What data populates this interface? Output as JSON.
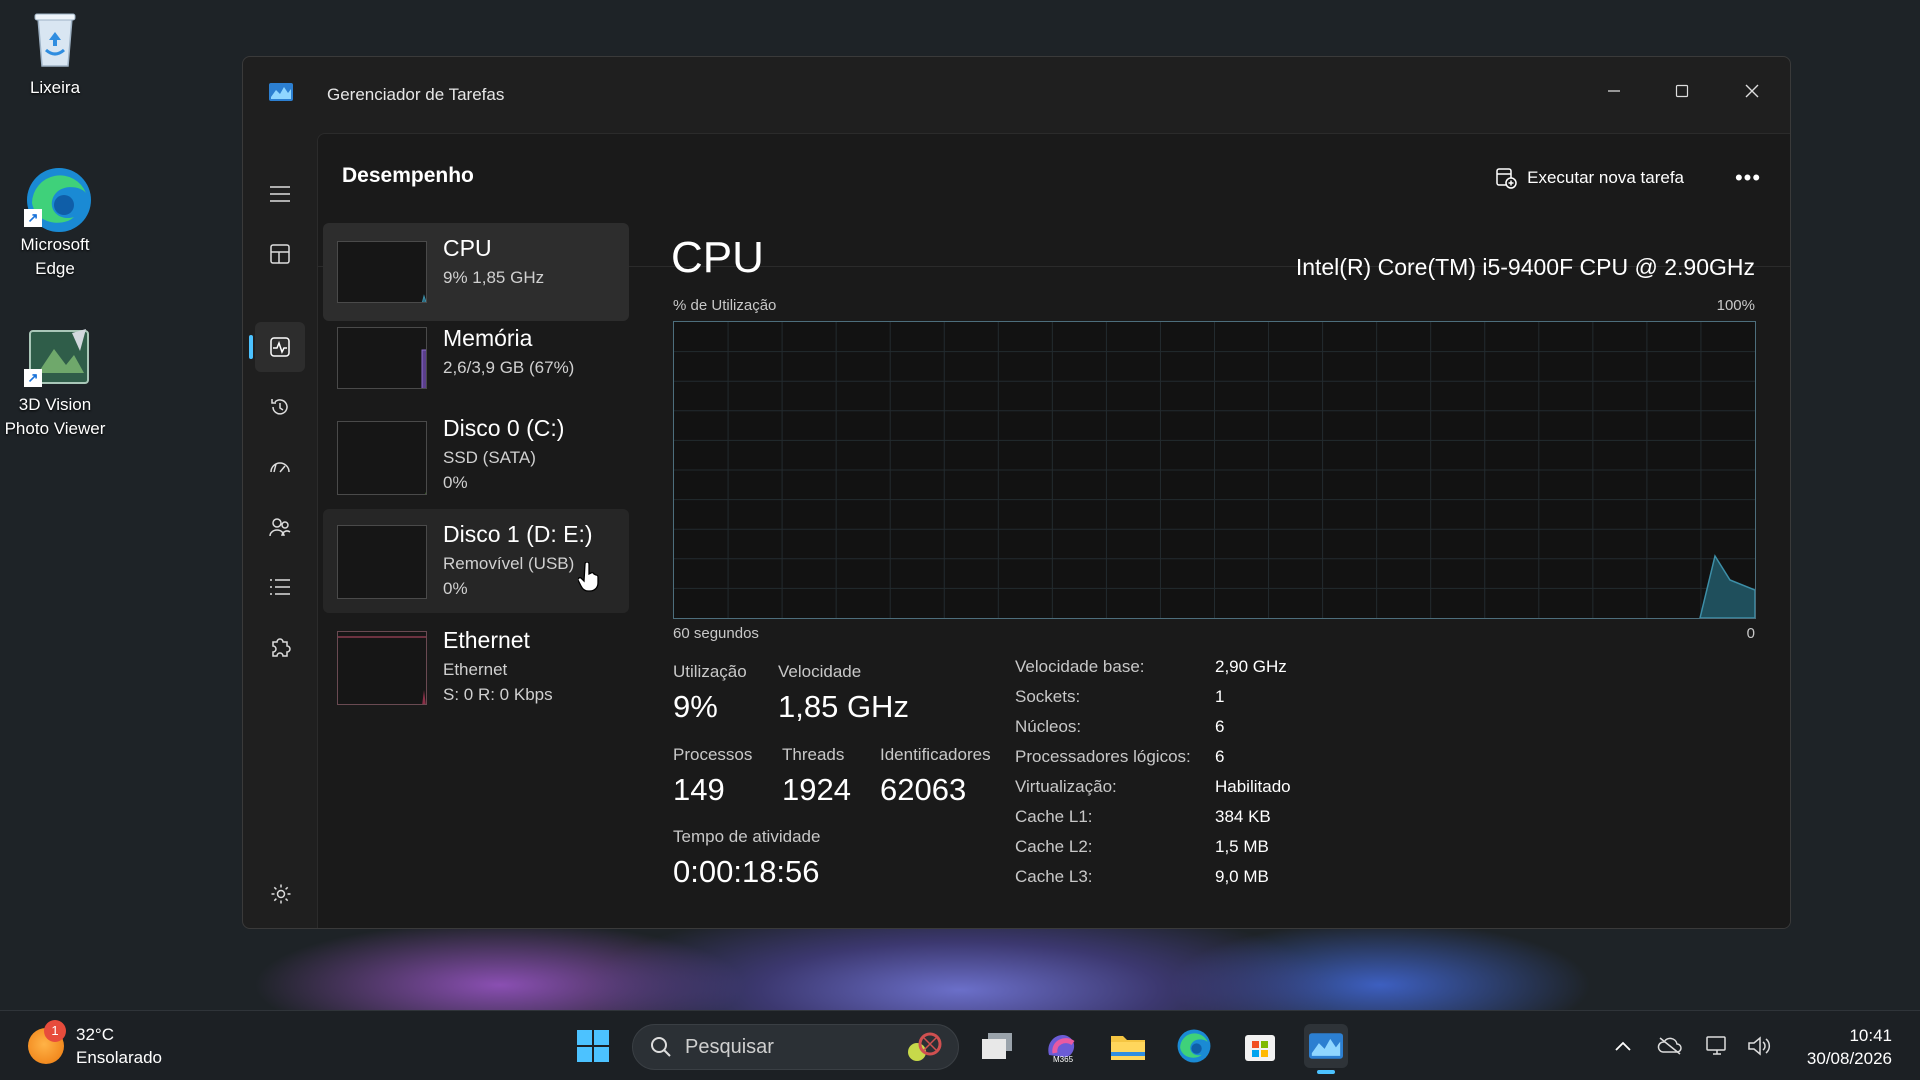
{
  "desktop": {
    "icons": [
      {
        "label": "Lixeira"
      },
      {
        "label": "Microsoft Edge"
      },
      {
        "label": "3D Vision Photo Viewer"
      }
    ]
  },
  "window": {
    "title": "Gerenciador de Tarefas",
    "page_title": "Desempenho",
    "run_task_label": "Executar nova tarefa",
    "more_label": "•••"
  },
  "perf_list": [
    {
      "name": "CPU",
      "sub1": "9%  1,85 GHz",
      "sub2": ""
    },
    {
      "name": "Memória",
      "sub1": "2,6/3,9 GB (67%)",
      "sub2": ""
    },
    {
      "name": "Disco 0 (C:)",
      "sub1": "SSD (SATA)",
      "sub2": "0%"
    },
    {
      "name": "Disco 1 (D: E:)",
      "sub1": "Removível (USB)",
      "sub2": "0%"
    },
    {
      "name": "Ethernet",
      "sub1": "Ethernet",
      "sub2": "S: 0 R: 0 Kbps"
    }
  ],
  "cpu": {
    "title": "CPU",
    "model": "Intel(R) Core(TM) i5-9400F CPU @ 2.90GHz",
    "graph_label": "% de Utilização",
    "graph_max": "100%",
    "graph_time": "60 segundos",
    "graph_min": "0",
    "stats": {
      "utilizacao_label": "Utilização",
      "utilizacao": "9%",
      "velocidade_label": "Velocidade",
      "velocidade": "1,85 GHz",
      "processos_label": "Processos",
      "processos": "149",
      "threads_label": "Threads",
      "threads": "1924",
      "identificadores_label": "Identificadores",
      "identificadores": "62063",
      "tempo_label": "Tempo de atividade",
      "tempo": "0:00:18:56"
    },
    "specs": [
      {
        "label": "Velocidade base:",
        "value": "2,90 GHz"
      },
      {
        "label": "Sockets:",
        "value": "1"
      },
      {
        "label": "Núcleos:",
        "value": "6"
      },
      {
        "label": "Processadores lógicos:",
        "value": "6"
      },
      {
        "label": "Virtualização:",
        "value": "Habilitado"
      },
      {
        "label": "Cache L1:",
        "value": "384 KB"
      },
      {
        "label": "Cache L2:",
        "value": "1,5 MB"
      },
      {
        "label": "Cache L3:",
        "value": "9,0 MB"
      }
    ]
  },
  "taskbar": {
    "weather_temp": "32°C",
    "weather_desc": "Ensolarado",
    "weather_badge": "1",
    "search_placeholder": "Pesquisar",
    "time": "10:41",
    "date": "30/08/2026"
  },
  "colors": {
    "accent": "#4cc2ff",
    "graph_fill": "#1f4f5c",
    "graph_line": "#3d8fa8",
    "window_bg": "#1f1f1f"
  }
}
